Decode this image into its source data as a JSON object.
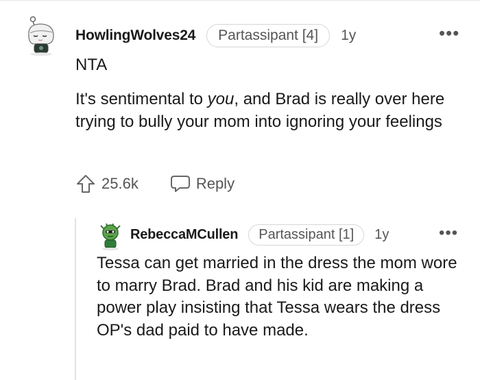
{
  "comment": {
    "username": "HowlingWolves24",
    "flair": "Partassipant [4]",
    "age": "1y",
    "more_label": "•••",
    "line1": "NTA",
    "para_before": "It's sentimental to ",
    "para_em": "you",
    "para_after": ", and Brad is really over here trying to bully your mom into ignoring your feelings",
    "upvotes": "25.6k",
    "reply_label": "Reply"
  },
  "reply": {
    "username": "RebeccaMCullen",
    "flair": "Partassipant [1]",
    "age": "1y",
    "more_label": "•••",
    "text": "Tessa can get married in the dress the mom wore to marry Brad. Brad and his kid are making a power play insisting that Tessa wears the dress OP's dad paid to have made."
  },
  "icons": {
    "upvote": "upvote-arrow-icon",
    "reply": "speech-bubble-icon",
    "more": "more-horizontal-icon"
  },
  "colors": {
    "text": "#1a1a1b",
    "meta": "#555555",
    "flair_border": "#d6d6d6",
    "thread_line": "#e3e3e3"
  }
}
